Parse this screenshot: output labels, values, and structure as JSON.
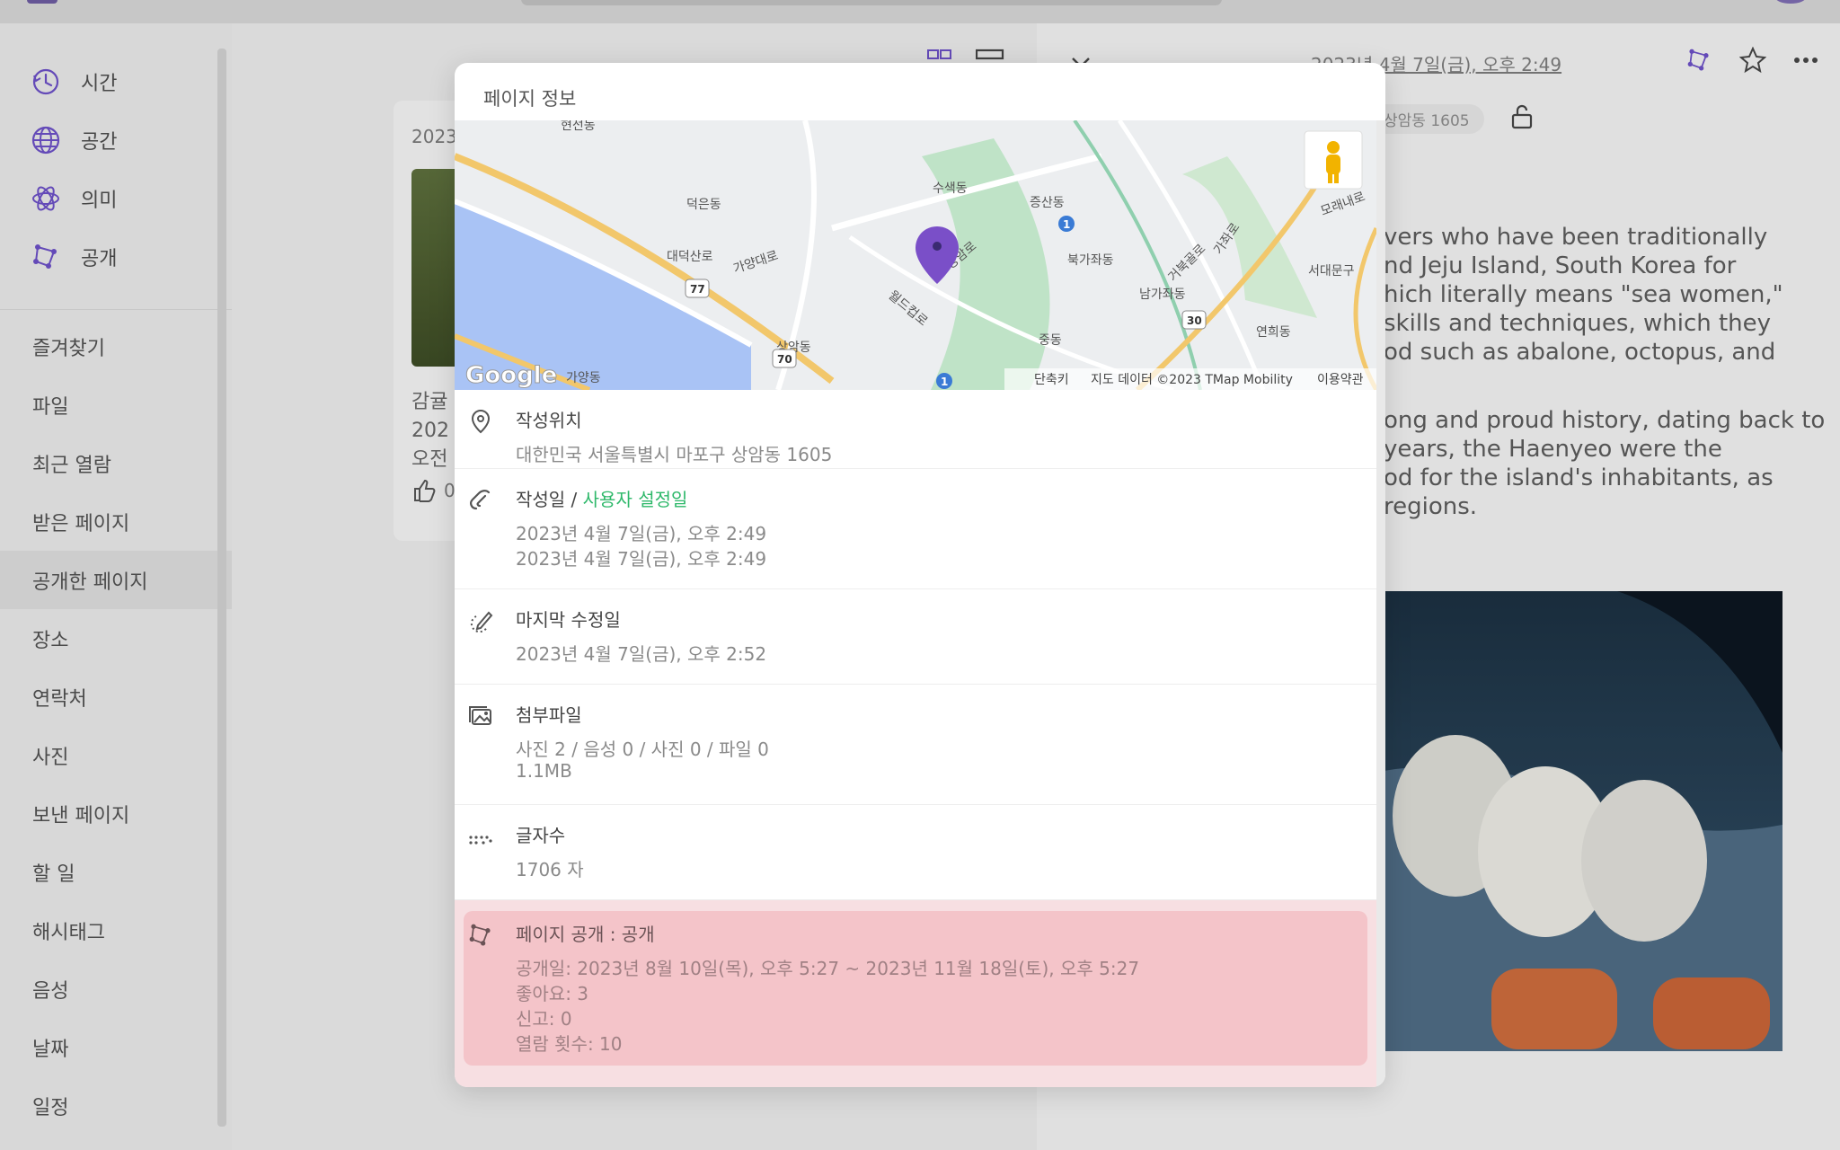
{
  "sidebar": {
    "top_items": [
      {
        "label": "시간",
        "icon": "clock-icon"
      },
      {
        "label": "공간",
        "icon": "globe-icon"
      },
      {
        "label": "의미",
        "icon": "atom-icon"
      },
      {
        "label": "공개",
        "icon": "share-network-icon"
      }
    ],
    "items": [
      "즐겨찾기",
      "파일",
      "최근 열람",
      "받은 페이지",
      "공개한 페이지",
      "장소",
      "연락처",
      "사진",
      "보낸 페이지",
      "할 일",
      "해시태그",
      "음성",
      "날짜",
      "일정"
    ],
    "active_item": "공개한 페이지"
  },
  "list": {
    "card_date": "2023",
    "card_lines": [
      "감귤",
      "202",
      "오전"
    ],
    "like_count": "0"
  },
  "article": {
    "date": "2023년 4월 7일(금), 오후 2:49",
    "location_tag": "상암동 1605",
    "para1": [
      "vers who have been traditionally",
      "nd Jeju Island, South Korea for",
      "hich literally means \"sea women,\"",
      "skills and techniques, which they",
      "od such as abalone, octopus, and"
    ],
    "para2": [
      "ong and proud history, dating back to",
      "years, the Haenyeo were the",
      "od for the island's inhabitants, as",
      "regions."
    ]
  },
  "modal": {
    "title": "페이지 정보",
    "map": {
      "labels": [
        "현전동",
        "덕은동",
        "수색동",
        "증산동",
        "대덕산로",
        "가양대로",
        "북가좌동",
        "남가좌동",
        "서대문구",
        "모래내로",
        "상암동",
        "가양동",
        "중동",
        "연희동",
        "월드컵로",
        "성암로",
        "거북골로",
        "가좌로"
      ],
      "road_numbers": [
        "77",
        "70",
        "1",
        "1",
        "30"
      ],
      "google": "Google",
      "footer": [
        "단축키",
        "지도 데이터 ©2023 TMap Mobility",
        "이용약관"
      ]
    },
    "location": {
      "label": "작성위치",
      "value": "대한민국 서울특별시 마포구 상암동 1605"
    },
    "created": {
      "label": "작성일",
      "sep": " / ",
      "label_custom": "사용자 설정일",
      "value": "2023년 4월 7일(금), 오후 2:49",
      "value_custom": "2023년 4월 7일(금), 오후 2:49"
    },
    "modified": {
      "label": "마지막 수정일",
      "value": "2023년 4월 7일(금), 오후 2:52"
    },
    "attachments": {
      "label": "첨부파일",
      "value": "사진 2 / 음성 0 / 사진 0 / 파일 0",
      "size": "1.1MB"
    },
    "char_count": {
      "label": "글자수",
      "value": "1706 자"
    },
    "publish": {
      "label": "페이지 공개 : 공개",
      "period": "공개일: 2023년 8월 10일(목), 오후 5:27 ~ 2023년 11월 18일(토), 오후 5:27",
      "likes": "좋아요: 3",
      "reports": "신고: 0",
      "views": "열람 횟수: 10"
    }
  },
  "colors": {
    "accent_purple": "#6a4fc2",
    "green": "#2eb86a",
    "public_bg": "#f4c4c9"
  }
}
